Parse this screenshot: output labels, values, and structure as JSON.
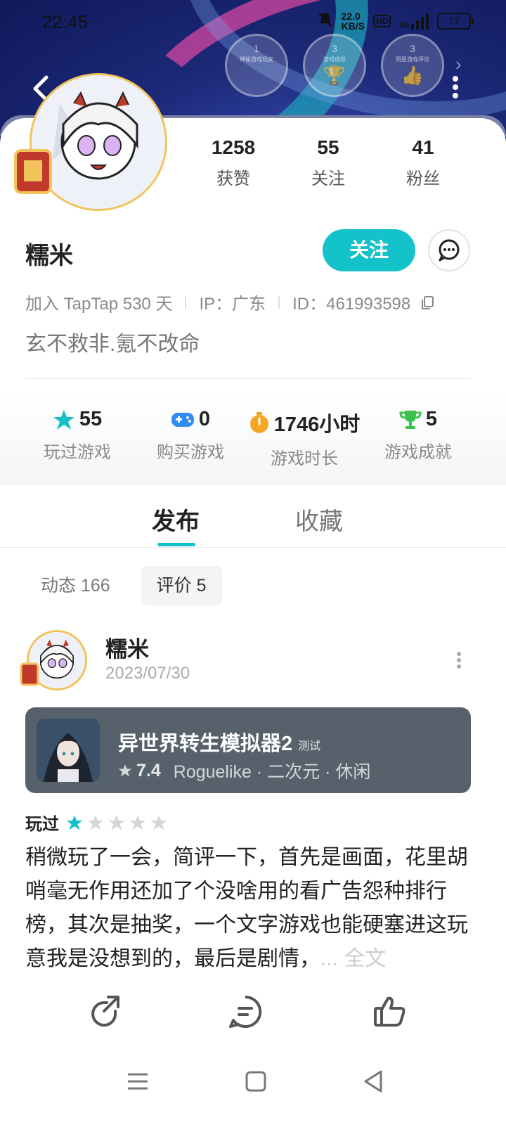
{
  "status_bar": {
    "time": "22:45",
    "net_speed": "22.0",
    "net_unit": "KB/S",
    "hd": "HD",
    "signal": "5G",
    "battery": "77"
  },
  "badges": [
    {
      "num": "1",
      "caption": "神秘游戏玩家"
    },
    {
      "num": "3",
      "caption": "游戏成就"
    },
    {
      "num": "3",
      "caption": "明星游戏评论"
    }
  ],
  "profile": {
    "stats": [
      {
        "value": "1258",
        "label": "获赞"
      },
      {
        "value": "55",
        "label": "关注"
      },
      {
        "value": "41",
        "label": "粉丝"
      }
    ],
    "name": "糯米",
    "follow_label": "关注",
    "meta": {
      "joined": "加入 TapTap 530 天",
      "ip": "IP：广东",
      "id": "ID：461993598"
    },
    "bio": "玄不救非.氪不改命"
  },
  "game_stats": [
    {
      "value": "55",
      "label": "玩过游戏",
      "icon": "star-icon",
      "color": "#17c0c8"
    },
    {
      "value": "0",
      "label": "购买游戏",
      "icon": "gamepad-icon",
      "color": "#2f8cf0"
    },
    {
      "value": "1746小时",
      "label": "游戏时长",
      "icon": "timer-icon",
      "color": "#f5a623"
    },
    {
      "value": "5",
      "label": "游戏成就",
      "icon": "trophy-icon",
      "color": "#3cc24a"
    }
  ],
  "tabs": [
    {
      "label": "发布",
      "active": true
    },
    {
      "label": "收藏",
      "active": false
    }
  ],
  "subtabs": [
    {
      "label": "动态 166",
      "active": false
    },
    {
      "label": "评价 5",
      "active": true
    }
  ],
  "post": {
    "author": "糯米",
    "date": "2023/07/30",
    "game": {
      "title": "异世界转生模拟器2",
      "tag": "测试",
      "rating": "7.4",
      "genres": "Roguelike · 二次元 · 休闲"
    },
    "played_label": "玩过",
    "stars": 1,
    "review": "稍微玩了一会，简评一下，首先是画面，花里胡哨毫无作用还加了个没啥用的看广告怨种排行榜，其次是抽奖，一个文字游戏也能硬塞进这玩意我是没想到的，最后是剧情，",
    "more_label": "... 全文"
  },
  "colors": {
    "accent": "#14c2c9",
    "game_card": "#56616b"
  }
}
